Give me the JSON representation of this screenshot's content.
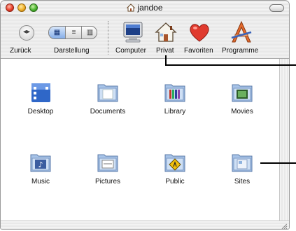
{
  "window": {
    "title": "jandoe"
  },
  "toolbar": {
    "back_label": "Zurück",
    "view_label": "Darstellung",
    "items": [
      {
        "label": "Computer",
        "icon": "computer-icon"
      },
      {
        "label": "Privat",
        "icon": "home-icon"
      },
      {
        "label": "Favoriten",
        "icon": "heart-icon"
      },
      {
        "label": "Programme",
        "icon": "applications-icon"
      }
    ]
  },
  "folders": [
    {
      "name": "Desktop",
      "icon": "desktop-folder-icon"
    },
    {
      "name": "Documents",
      "icon": "documents-folder-icon"
    },
    {
      "name": "Library",
      "icon": "library-folder-icon"
    },
    {
      "name": "Movies",
      "icon": "movies-folder-icon"
    },
    {
      "name": "Music",
      "icon": "music-folder-icon"
    },
    {
      "name": "Pictures",
      "icon": "pictures-folder-icon"
    },
    {
      "name": "Public",
      "icon": "public-folder-icon"
    },
    {
      "name": "Sites",
      "icon": "sites-folder-icon"
    }
  ],
  "colors": {
    "folder_blue": "#8fb3df",
    "highlight": "#86aee9"
  }
}
